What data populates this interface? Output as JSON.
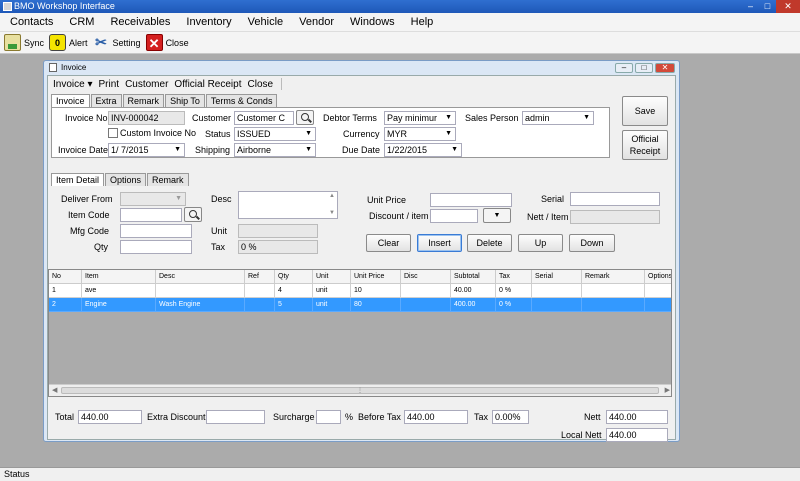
{
  "app": {
    "title": "BMO Workshop Interface"
  },
  "menubar": [
    "Contacts",
    "CRM",
    "Receivables",
    "Inventory",
    "Vehicle",
    "Vendor",
    "Windows",
    "Help"
  ],
  "toolbar": {
    "sync": "Sync",
    "alert_badge": "0",
    "alert": "Alert",
    "setting": "Setting",
    "close": "Close"
  },
  "status": "Status",
  "invoice": {
    "window_title": "Invoice",
    "menu": {
      "invoice": "Invoice",
      "print": "Print",
      "customer": "Customer",
      "official_receipt": "Official Receipt",
      "close": "Close"
    },
    "tabs": [
      "Invoice",
      "Extra",
      "Remark",
      "Ship To",
      "Terms & Conds"
    ],
    "header": {
      "invoice_no_label": "Invoice No",
      "invoice_no": "INV-000042",
      "custom_invoice_no": "Custom Invoice No",
      "invoice_date_label": "Invoice Date",
      "invoice_date": "1/ 7/2015",
      "customer_label": "Customer",
      "customer": "Customer C",
      "status_label": "Status",
      "status": "ISSUED",
      "shipping_label": "Shipping",
      "shipping": "Airborne",
      "debtor_terms_label": "Debtor Terms",
      "debtor_terms": "Pay minimur",
      "currency_label": "Currency",
      "currency": "MYR",
      "due_date_label": "Due Date",
      "due_date": "1/22/2015",
      "sales_person_label": "Sales Person",
      "sales_person": "admin"
    },
    "side_buttons": {
      "save": "Save",
      "official_receipt_1": "Official",
      "official_receipt_2": "Receipt"
    },
    "item_tabs": [
      "Item Detail",
      "Options",
      "Remark"
    ],
    "item": {
      "deliver_from": "Deliver From",
      "item_code": "Item Code",
      "mfg_code": "Mfg Code",
      "qty": "Qty",
      "desc": "Desc",
      "unit": "Unit",
      "tax": "Tax",
      "tax_value": "0 %",
      "unit_price": "Unit Price",
      "discount": "Discount / item",
      "serial": "Serial",
      "nett_item": "Nett / Item"
    },
    "item_buttons": {
      "clear": "Clear",
      "insert": "Insert",
      "delete": "Delete",
      "up": "Up",
      "down": "Down"
    },
    "grid": {
      "columns": [
        "No",
        "Item",
        "Desc",
        "Ref",
        "Qty",
        "Unit",
        "Unit Price",
        "Disc",
        "Subtotal",
        "Tax",
        "Serial",
        "Remark",
        "Options"
      ],
      "rows": [
        [
          "1",
          "ave",
          "",
          "",
          "4",
          "unit",
          "10",
          "",
          "40.00",
          "0 %",
          "",
          "",
          ""
        ],
        [
          "2",
          "Engine",
          "Wash Engine",
          "",
          "5",
          "unit",
          "80",
          "",
          "400.00",
          "0 %",
          "",
          "",
          ""
        ]
      ]
    },
    "totals": {
      "total_label": "Total",
      "total": "440.00",
      "extra_discount_label": "Extra Discount",
      "extra_discount": "",
      "surcharge_label": "Surcharge",
      "surcharge": "",
      "percent": "%",
      "before_tax_label": "Before Tax",
      "before_tax": "440.00",
      "tax_label": "Tax",
      "tax": "0.00%",
      "nett_label": "Nett",
      "nett": "440.00",
      "local_nett_label": "Local Nett",
      "local_nett": "440.00"
    }
  }
}
